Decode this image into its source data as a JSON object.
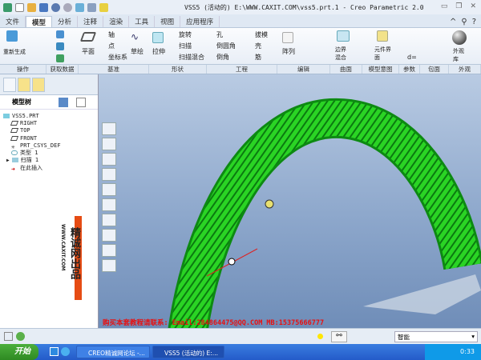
{
  "window": {
    "title": "VSS5 (活动的) E:\\WWW.CAXIT.COM\\vss5.prt.1 - Creo Parametric 2.0"
  },
  "tabs": [
    "文件",
    "模型",
    "分析",
    "注释",
    "渲染",
    "工具",
    "视图",
    "应用程序"
  ],
  "ribbon": {
    "regen": "重新生成",
    "axis": "轴",
    "point": "点",
    "csys": "坐标系",
    "plane": "平面",
    "sketch": "草绘",
    "extrude": "拉伸",
    "revolve": "旋转",
    "sweep": "扫描",
    "swept_blend": "扫描混合",
    "hole": "孔",
    "round": "倒圆角",
    "chamfer": "倒角",
    "draft": "拔模",
    "shell": "壳",
    "rib": "筋",
    "pattern": "阵列",
    "boundary_blend": "边界混合",
    "component_interface": "元件界面",
    "d": "d=",
    "appearance": "外观库"
  },
  "groups": [
    "操作",
    "获取数据",
    "基准",
    "形状",
    "工程",
    "编辑",
    "曲面",
    "模型意图",
    "参数",
    "包面",
    "外观"
  ],
  "tree": {
    "header": "模型树",
    "items": [
      "VSS5.PRT",
      "RIGHT",
      "TOP",
      "FRONT",
      "PRT_CSYS_DEF",
      "类型 1",
      "扫描 1",
      "在此插入"
    ]
  },
  "watermark": {
    "text": "精诚网出品",
    "site": "WWW.CAXIT.COM"
  },
  "promo": "购买本套教程请联系: Email:284864475@QQ.COM MB:15375666777",
  "status": {
    "filter": "智能"
  },
  "taskbar": {
    "start": "开始",
    "tasks": [
      "CREO精诚网论坛 -...",
      "VSS5 (活动的) E:..."
    ],
    "clock": "0:33"
  },
  "colors": {
    "rope": "#22c51e",
    "viewport": "#8ea8cc",
    "accent": "#e64c14"
  }
}
